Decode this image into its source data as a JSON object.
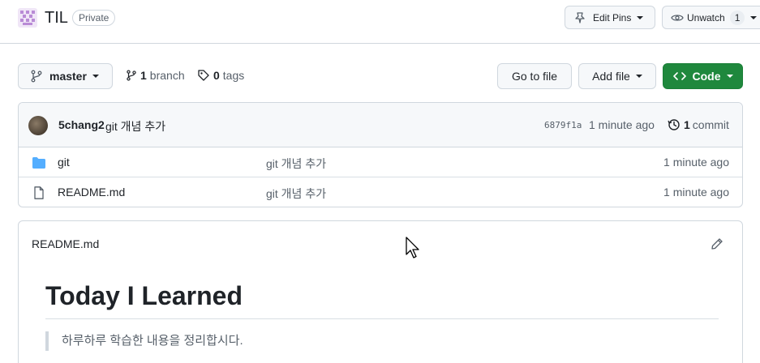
{
  "repo": {
    "name": "TIL",
    "visibility": "Private"
  },
  "header_actions": {
    "edit_pins": "Edit Pins",
    "unwatch": "Unwatch",
    "watch_count": "1"
  },
  "toolbar": {
    "branch": "master",
    "branch_count": "1",
    "branch_label": "branch",
    "tag_count": "0",
    "tag_label": "tags",
    "go_to_file": "Go to file",
    "add_file": "Add file",
    "code": "Code"
  },
  "latest_commit": {
    "author": "5chang2",
    "message": "git 개념 추가",
    "sha": "6879f1a",
    "time": "1 minute ago",
    "count": "1",
    "count_label": "commit"
  },
  "files": [
    {
      "type": "folder",
      "name": "git",
      "commit": "git 개념 추가",
      "time": "1 minute ago"
    },
    {
      "type": "file",
      "name": "README.md",
      "commit": "git 개념 추가",
      "time": "1 minute ago"
    }
  ],
  "readme": {
    "filename": "README.md",
    "heading": "Today I Learned",
    "quote": "하루하루 학습한 내용을 정리합시다."
  },
  "colors": {
    "primary_button": "#1f883d",
    "folder_icon": "#54aeff",
    "border": "#d0d7de",
    "muted_text": "#57606a"
  },
  "icons": [
    "repo-identicon-icon",
    "pin-icon",
    "eye-icon",
    "git-branch-icon",
    "tag-icon",
    "code-icon",
    "history-icon",
    "folder-icon",
    "file-icon",
    "pencil-icon",
    "mouse-cursor"
  ]
}
